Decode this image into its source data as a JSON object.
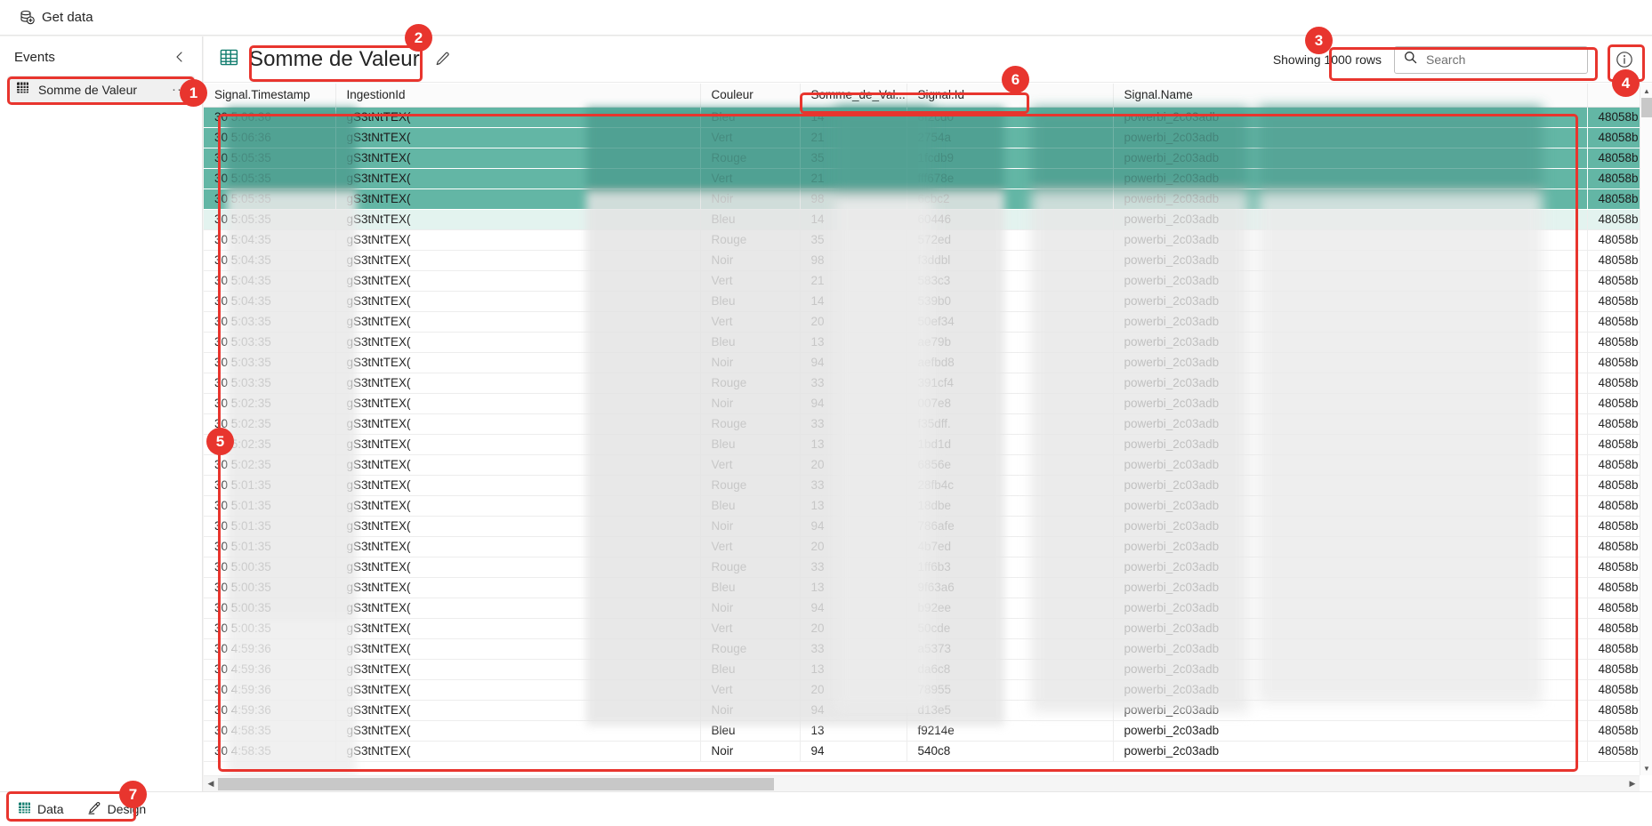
{
  "ribbon": {
    "get_data_label": "Get data",
    "get_data_icon": "database-add-icon"
  },
  "sidebar": {
    "title": "Events",
    "collapse_icon": "chevron-left-icon",
    "items": [
      {
        "label": "Somme de Valeur",
        "icon": "table-grid-icon",
        "overflow": "···",
        "selected": true
      }
    ]
  },
  "header": {
    "icon": "table-grid-icon",
    "title": "Somme de Valeur",
    "edit_icon": "pencil-icon",
    "showing_rows": "Showing 1000 rows",
    "search": {
      "icon": "search-icon",
      "value": "",
      "placeholder": "Search"
    },
    "info_icon": "info-circle-icon"
  },
  "table": {
    "columns": [
      "Signal.Timestamp",
      "IngestionId",
      "Couleur",
      "Somme_de_Val...",
      "Signal.Id",
      "Signal.Name",
      ""
    ],
    "rows": [
      {
        "ts": "30",
        "time": "5:06:36",
        "ingestion": "gS3tNtTEX(",
        "couleur": "Bleu",
        "somme": "14",
        "sigid": "8f2cd0",
        "name": "powerbi_2c03adb",
        "tail": "48058b",
        "selected": true
      },
      {
        "ts": "30",
        "time": "5:06:36",
        "ingestion": "gS3tNtTEX(",
        "couleur": "Vert",
        "somme": "21",
        "sigid": "2754a",
        "name": "powerbi_2c03adb",
        "tail": "48058b",
        "selected": true
      },
      {
        "ts": "30",
        "time": "5:05:35",
        "ingestion": "gS3tNtTEX(",
        "couleur": "Rouge",
        "somme": "35",
        "sigid": "1fcdb9",
        "name": "powerbi_2c03adb",
        "tail": "48058b",
        "selected": true
      },
      {
        "ts": "30",
        "time": "5:05:35",
        "ingestion": "gS3tNtTEX(",
        "couleur": "Vert",
        "somme": "21",
        "sigid": "fff678e",
        "name": "powerbi_2c03adb",
        "tail": "48058b",
        "selected": true
      },
      {
        "ts": "30",
        "time": "5:05:35",
        "ingestion": "gS3tNtTEX(",
        "couleur": "Noir",
        "somme": "98",
        "sigid": "6cbc2",
        "name": "powerbi_2c03adb",
        "tail": "48058b",
        "selected": true
      },
      {
        "ts": "30",
        "time": "5:05:35",
        "ingestion": "gS3tNtTEX(",
        "couleur": "Bleu",
        "somme": "14",
        "sigid": "60446",
        "name": "powerbi_2c03adb",
        "tail": "48058b",
        "selected": false
      },
      {
        "ts": "30",
        "time": "5:04:35",
        "ingestion": "gS3tNtTEX(",
        "couleur": "Rouge",
        "somme": "35",
        "sigid": "572ed",
        "name": "powerbi_2c03adb",
        "tail": "48058b",
        "selected": false
      },
      {
        "ts": "30",
        "time": "5:04:35",
        "ingestion": "gS3tNtTEX(",
        "couleur": "Noir",
        "somme": "98",
        "sigid": "f3ddbl",
        "name": "powerbi_2c03adb",
        "tail": "48058b",
        "selected": false
      },
      {
        "ts": "30",
        "time": "5:04:35",
        "ingestion": "gS3tNtTEX(",
        "couleur": "Vert",
        "somme": "21",
        "sigid": "583c3",
        "name": "powerbi_2c03adb",
        "tail": "48058b",
        "selected": false
      },
      {
        "ts": "30",
        "time": "5:04:35",
        "ingestion": "gS3tNtTEX(",
        "couleur": "Bleu",
        "somme": "14",
        "sigid": "539b0",
        "name": "powerbi_2c03adb",
        "tail": "48058b",
        "selected": false
      },
      {
        "ts": "30",
        "time": "5:03:35",
        "ingestion": "gS3tNtTEX(",
        "couleur": "Vert",
        "somme": "20",
        "sigid": "50ef34",
        "name": "powerbi_2c03adb",
        "tail": "48058b",
        "selected": false
      },
      {
        "ts": "30",
        "time": "5:03:35",
        "ingestion": "gS3tNtTEX(",
        "couleur": "Bleu",
        "somme": "13",
        "sigid": "ae79b",
        "name": "powerbi_2c03adb",
        "tail": "48058b",
        "selected": false
      },
      {
        "ts": "30",
        "time": "5:03:35",
        "ingestion": "gS3tNtTEX(",
        "couleur": "Noir",
        "somme": "94",
        "sigid": "aefbd8",
        "name": "powerbi_2c03adb",
        "tail": "48058b",
        "selected": false
      },
      {
        "ts": "30",
        "time": "5:03:35",
        "ingestion": "gS3tNtTEX(",
        "couleur": "Rouge",
        "somme": "33",
        "sigid": "391cf4",
        "name": "powerbi_2c03adb",
        "tail": "48058b",
        "selected": false
      },
      {
        "ts": "30",
        "time": "5:02:35",
        "ingestion": "gS3tNtTEX(",
        "couleur": "Noir",
        "somme": "94",
        "sigid": "007e8",
        "name": "powerbi_2c03adb",
        "tail": "48058b",
        "selected": false
      },
      {
        "ts": "30",
        "time": "5:02:35",
        "ingestion": "gS3tNtTEX(",
        "couleur": "Rouge",
        "somme": "33",
        "sigid": "f35dff.",
        "name": "powerbi_2c03adb",
        "tail": "48058b",
        "selected": false
      },
      {
        "ts": "30",
        "time": "5:02:35",
        "ingestion": "gS3tNtTEX(",
        "couleur": "Bleu",
        "somme": "13",
        "sigid": "1bd1d",
        "name": "powerbi_2c03adb",
        "tail": "48058b",
        "selected": false
      },
      {
        "ts": "30",
        "time": "5:02:35",
        "ingestion": "gS3tNtTEX(",
        "couleur": "Vert",
        "somme": "20",
        "sigid": "6856e",
        "name": "powerbi_2c03adb",
        "tail": "48058b",
        "selected": false
      },
      {
        "ts": "30",
        "time": "5:01:35",
        "ingestion": "gS3tNtTEX(",
        "couleur": "Rouge",
        "somme": "33",
        "sigid": "28fb4c",
        "name": "powerbi_2c03adb",
        "tail": "48058b",
        "selected": false
      },
      {
        "ts": "30",
        "time": "5:01:35",
        "ingestion": "gS3tNtTEX(",
        "couleur": "Bleu",
        "somme": "13",
        "sigid": "18dbe",
        "name": "powerbi_2c03adb",
        "tail": "48058b",
        "selected": false
      },
      {
        "ts": "30",
        "time": "5:01:35",
        "ingestion": "gS3tNtTEX(",
        "couleur": "Noir",
        "somme": "94",
        "sigid": "786afe",
        "name": "powerbi_2c03adb",
        "tail": "48058b",
        "selected": false
      },
      {
        "ts": "30",
        "time": "5:01:35",
        "ingestion": "gS3tNtTEX(",
        "couleur": "Vert",
        "somme": "20",
        "sigid": "4b7ed",
        "name": "powerbi_2c03adb",
        "tail": "48058b",
        "selected": false
      },
      {
        "ts": "30",
        "time": "5:00:35",
        "ingestion": "gS3tNtTEX(",
        "couleur": "Rouge",
        "somme": "33",
        "sigid": "1ff6b3",
        "name": "powerbi_2c03adb",
        "tail": "48058b",
        "selected": false
      },
      {
        "ts": "30",
        "time": "5:00:35",
        "ingestion": "gS3tNtTEX(",
        "couleur": "Bleu",
        "somme": "13",
        "sigid": "9f63a6",
        "name": "powerbi_2c03adb",
        "tail": "48058b",
        "selected": false
      },
      {
        "ts": "30",
        "time": "5:00:35",
        "ingestion": "gS3tNtTEX(",
        "couleur": "Noir",
        "somme": "94",
        "sigid": "b92ee",
        "name": "powerbi_2c03adb",
        "tail": "48058b",
        "selected": false
      },
      {
        "ts": "30",
        "time": "5:00:35",
        "ingestion": "gS3tNtTEX(",
        "couleur": "Vert",
        "somme": "20",
        "sigid": "50cde",
        "name": "powerbi_2c03adb",
        "tail": "48058b",
        "selected": false
      },
      {
        "ts": "30",
        "time": "4:59:36",
        "ingestion": "gS3tNtTEX(",
        "couleur": "Rouge",
        "somme": "33",
        "sigid": "a5373",
        "name": "powerbi_2c03adb",
        "tail": "48058b",
        "selected": false
      },
      {
        "ts": "30",
        "time": "4:59:36",
        "ingestion": "gS3tNtTEX(",
        "couleur": "Bleu",
        "somme": "13",
        "sigid": "da6c8",
        "name": "powerbi_2c03adb",
        "tail": "48058b",
        "selected": false
      },
      {
        "ts": "30",
        "time": "4:59:36",
        "ingestion": "gS3tNtTEX(",
        "couleur": "Vert",
        "somme": "20",
        "sigid": "78955",
        "name": "powerbi_2c03adb",
        "tail": "48058b",
        "selected": false
      },
      {
        "ts": "30",
        "time": "4:59:36",
        "ingestion": "gS3tNtTEX(",
        "couleur": "Noir",
        "somme": "94",
        "sigid": "d13e5",
        "name": "powerbi_2c03adb",
        "tail": "48058b",
        "selected": false
      },
      {
        "ts": "30",
        "time": "4:58:35",
        "ingestion": "gS3tNtTEX(",
        "couleur": "Bleu",
        "somme": "13",
        "sigid": "f9214e",
        "name": "powerbi_2c03adb",
        "tail": "48058b",
        "selected": false
      },
      {
        "ts": "30",
        "time": "4:58:35",
        "ingestion": "gS3tNtTEX(",
        "couleur": "Noir",
        "somme": "94",
        "sigid": "540c8",
        "name": "powerbi_2c03adb",
        "tail": "48058b",
        "selected": false
      }
    ]
  },
  "statusbar": {
    "tabs": [
      {
        "label": "Data",
        "icon": "table-grid-icon"
      },
      {
        "label": "Design",
        "icon": "pencil-design-icon"
      }
    ]
  },
  "annotations": {
    "badges": [
      "1",
      "2",
      "3",
      "4",
      "5",
      "6",
      "7"
    ],
    "color": "#e8352e"
  },
  "colors": {
    "accent_teal": "#107c6e",
    "selection_teal": "#63b6a5",
    "annotation_red": "#e8352e",
    "sidebar_selected": "#f0f0f0"
  }
}
